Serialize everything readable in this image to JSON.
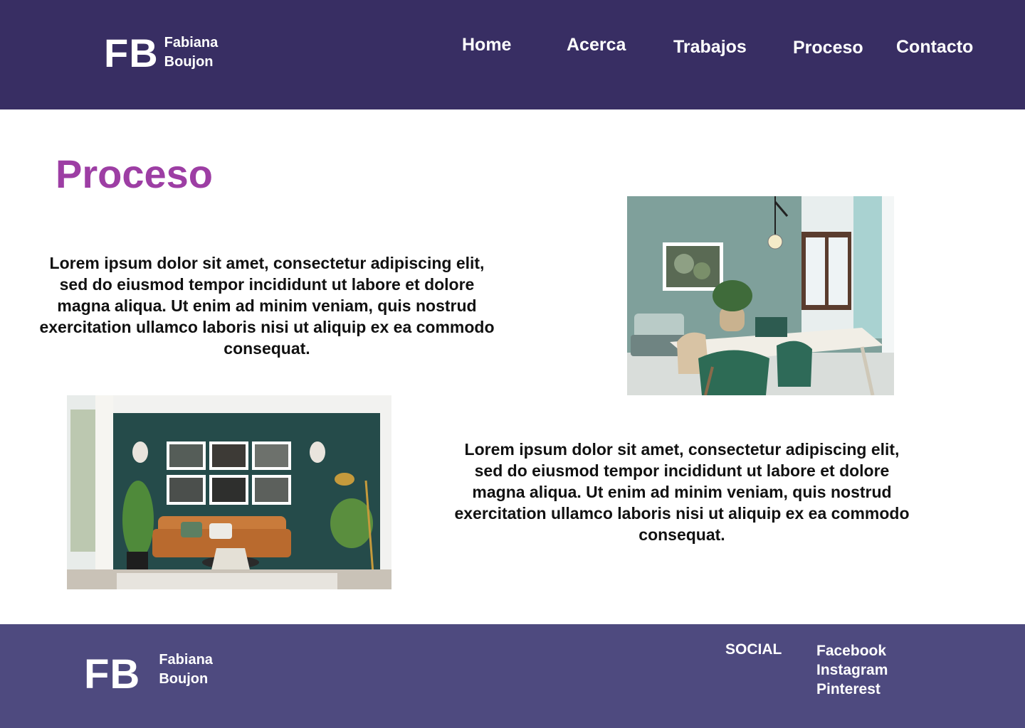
{
  "header": {
    "logo": {
      "mark": "FB",
      "first_name": "Fabiana",
      "last_name": "Boujon"
    },
    "nav": [
      {
        "label": "Home"
      },
      {
        "label": "Acerca"
      },
      {
        "label": "Trabajos"
      },
      {
        "label": "Proceso"
      },
      {
        "label": "Contacto"
      }
    ]
  },
  "main": {
    "title": "Proceso",
    "sections": [
      {
        "text": "Lorem ipsum dolor sit amet, consectetur adipiscing elit, sed do eiusmod tempor incididunt ut labore et dolore magna aliqua. Ut enim ad minim veniam, quis nostrud exercitation ullamco laboris nisi ut aliquip ex ea commodo consequat."
      },
      {
        "text": "Lorem ipsum dolor sit amet, consectetur adipiscing elit, sed do eiusmod tempor incididunt ut labore et dolore magna aliqua. Ut enim ad minim veniam, quis nostrud exercitation ullamco laboris nisi ut aliquip ex ea commodo consequat."
      }
    ]
  },
  "footer": {
    "logo": {
      "mark": "FB",
      "first_name": "Fabiana",
      "last_name": "Boujon"
    },
    "social_heading": "SOCIAL",
    "social_links": [
      {
        "label": "Facebook"
      },
      {
        "label": "Instagram"
      },
      {
        "label": "Pinterest"
      }
    ]
  },
  "colors": {
    "header_bg": "#382e63",
    "footer_bg": "#4e4a7f",
    "title": "#9d3ea4",
    "text": "#111111"
  }
}
